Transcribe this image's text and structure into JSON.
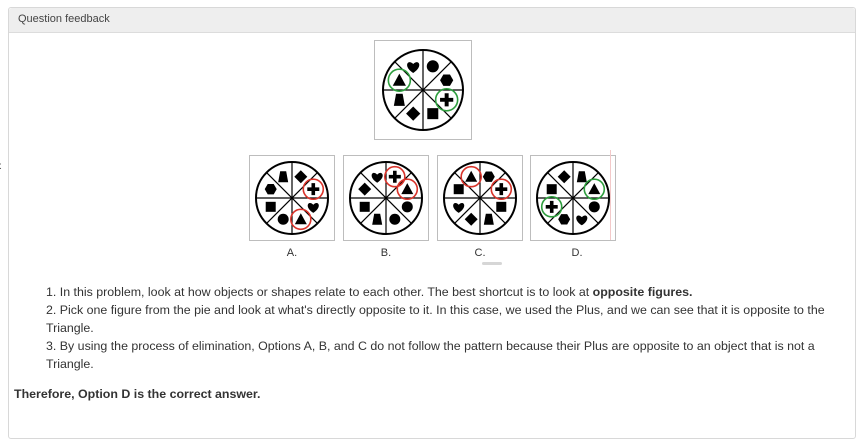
{
  "header": {
    "title": "Question feedback"
  },
  "colors": {
    "ring_red": "#d9342b",
    "ring_green": "#2e9e3e",
    "shape": "#000000"
  },
  "main_figure": {
    "sectors": [
      "heart-icon",
      "circle-icon",
      "hexagon-icon",
      "plus-icon",
      "square-icon",
      "diamond-icon",
      "trapezoid-icon",
      "triangle-icon"
    ],
    "rings": {
      "triangle-icon": "green",
      "plus-icon": "green"
    }
  },
  "options": [
    {
      "label": "A.",
      "sectors": [
        "trapezoid-icon",
        "diamond-icon",
        "plus-icon",
        "heart-icon",
        "triangle-icon",
        "circle-icon",
        "square-icon",
        "hexagon-icon"
      ],
      "rings": {
        "plus-icon": "red",
        "triangle-icon": "red"
      }
    },
    {
      "label": "B.",
      "sectors": [
        "heart-icon",
        "plus-icon",
        "triangle-icon",
        "circle-icon",
        "circle-icon",
        "trapezoid-icon",
        "square-icon",
        "diamond-icon"
      ],
      "rings": {
        "plus-icon": "red",
        "triangle-icon": "red"
      }
    },
    {
      "label": "C.",
      "sectors": [
        "triangle-icon",
        "hexagon-icon",
        "plus-icon",
        "square-icon",
        "trapezoid-icon",
        "diamond-icon",
        "heart-icon",
        "square-icon"
      ],
      "rings": {
        "triangle-icon": "red",
        "plus-icon": "red"
      }
    },
    {
      "label": "D.",
      "sectors": [
        "diamond-icon",
        "trapezoid-icon",
        "triangle-icon",
        "circle-icon",
        "heart-icon",
        "hexagon-icon",
        "plus-icon",
        "square-icon"
      ],
      "rings": {
        "plus-icon": "green",
        "triangle-icon": "green"
      }
    }
  ],
  "explanation": {
    "line1_prefix": "1. In this problem, look at how objects or shapes relate to each other. The best shortcut is to look at ",
    "line1_bold": "opposite figures.",
    "line2": "2. Pick one figure from the pie and look at what's directly opposite to it. In this case, we used the Plus, and we can see that it is opposite to the Triangle.",
    "line3": "3. By using the process of elimination, Options A, B, and C do not follow the pattern because their Plus are opposite to an object that is not a Triangle."
  },
  "conclusion": "Therefore, Option D is the correct answer."
}
